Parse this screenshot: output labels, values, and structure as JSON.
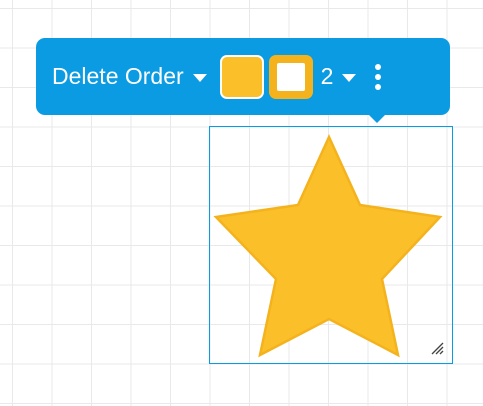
{
  "toolbar": {
    "action_label": "Delete Order",
    "line_width": "2",
    "fill_color": "#fbbf2a",
    "stroke_color": "#f4b31d",
    "background_color": "#0a9be3"
  },
  "shape": {
    "type": "star",
    "fill_color": "#fbbf2a",
    "stroke_color": "#f4b31d"
  },
  "icons": {
    "action_dropdown": "chevron-down-icon",
    "width_dropdown": "chevron-down-icon",
    "more": "more-vertical-icon",
    "resize": "resize-handle-icon"
  }
}
